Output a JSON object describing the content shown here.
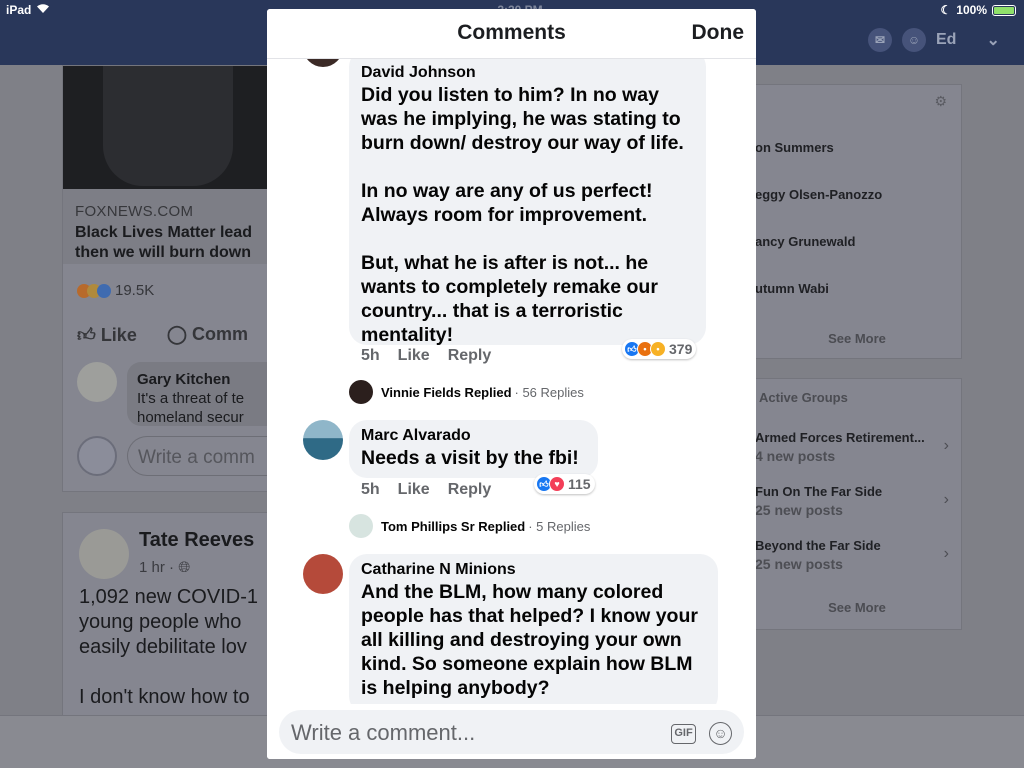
{
  "status_bar": {
    "device": "iPad",
    "time": "2:20 PM",
    "battery": "100%"
  },
  "fb_header": {
    "user_name": "Ed"
  },
  "background_feed": {
    "post1": {
      "source": "FOXNEWS.COM",
      "headline_lines": [
        "Black Lives Matter lead",
        "then we will burn down"
      ],
      "reaction_count": "19.5K",
      "like_label": "Like",
      "comment_label": "Comm",
      "commenter_name": "Gary Kitchen",
      "comment_lines": [
        "It's a threat of te",
        "homeland secur"
      ],
      "write_placeholder": "Write a comm"
    },
    "post2": {
      "poster": "Tate Reeves",
      "time": "1 hr ·",
      "lines": [
        "1,092 new COVID-1",
        "young people who",
        "easily debilitate lov",
        "I don't know how to"
      ]
    }
  },
  "sidebar": {
    "people": [
      "on Summers",
      "eggy Olsen-Panozzo",
      "ancy Grunewald",
      "utumn Wabi"
    ],
    "see_more": "See More",
    "groups_title": "Active Groups",
    "groups": [
      {
        "name": "Armed Forces Retirement...",
        "sub": "4 new posts"
      },
      {
        "name": "Fun On The Far Side",
        "sub": "25 new posts"
      },
      {
        "name": "Beyond the Far Side",
        "sub": "25 new posts"
      }
    ],
    "groups_see_more": "See More"
  },
  "modal": {
    "title": "Comments",
    "done_label": "Done",
    "comments": [
      {
        "author": "David Johnson",
        "text": "Did you listen to him?   In no way was he implying, he was stating to burn down/ destroy our way of life.\n\nIn no way are any of us perfect! Always room for improvement.\n\nBut, what he is after is not... he wants to completely remake our country... that is a terroristic mentality!",
        "time": "5h",
        "like_label": "Like",
        "reply_label": "Reply",
        "reaction_count": "379",
        "reply_summary": {
          "name": "Vinnie Fields Replied",
          "count": "· 56 Replies"
        }
      },
      {
        "author": "Marc Alvarado",
        "text": "Needs a visit by the fbi!",
        "time": "5h",
        "like_label": "Like",
        "reply_label": "Reply",
        "reaction_count": "115",
        "reply_summary": {
          "name": "Tom Phillips Sr Replied",
          "count": "· 5 Replies"
        }
      },
      {
        "author": "Catharine N Minions",
        "text": "And the BLM, how many colored people has that helped? I know your all killing and destroying your own kind. So someone explain how BLM is helping anybody?"
      }
    ],
    "composer": {
      "placeholder": "Write a comment...",
      "gif_label": "GIF"
    }
  },
  "colors": {
    "fb_blue": "#29375a",
    "bubble_bg": "#f0f2f5",
    "like_blue": "#1877f2"
  }
}
